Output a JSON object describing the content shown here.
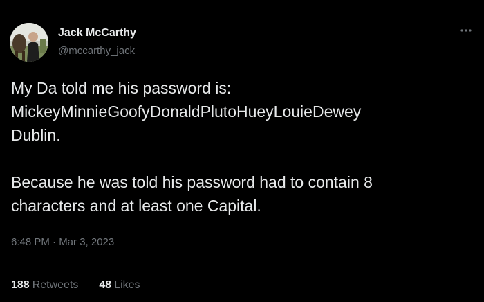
{
  "author": {
    "name": "Jack McCarthy",
    "handle": "@mccarthy_jack"
  },
  "more_icon": "more-horizontal-icon",
  "tweet": {
    "lines": [
      "My Da told me his password is:",
      "MickeyMinnieGoofyDonaldPlutoHueyLouieDewey",
      "Dublin.",
      "Because he was told his password had to contain 8",
      "characters and at least one Capital."
    ]
  },
  "timestamp": "6:48 PM · Mar 3, 2023",
  "stats": {
    "retweets_count": "188",
    "retweets_label": "Retweets",
    "likes_count": "48",
    "likes_label": "Likes"
  },
  "colors": {
    "background": "#000000",
    "text": "#e7e9ea",
    "secondary_text": "#71767b",
    "divider": "#2f3336"
  }
}
